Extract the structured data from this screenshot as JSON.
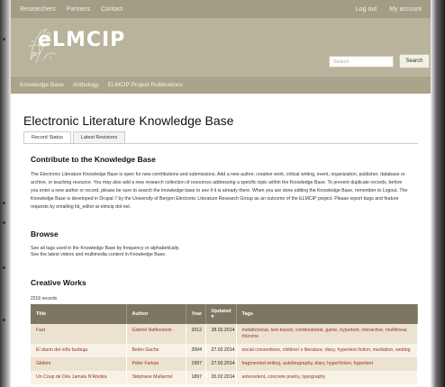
{
  "topbar": {
    "left": [
      "Researchers",
      "Partners",
      "Contact"
    ],
    "right": [
      "Log out",
      "My account"
    ]
  },
  "header": {
    "logo_text": "eLMCIP",
    "search_placeholder": "Search",
    "search_button": "Search"
  },
  "mainnav": [
    "Knowledge Base",
    "Anthology",
    "ELMCIP Project Publications"
  ],
  "page": {
    "title": "Electronic Literature Knowledge Base",
    "tabs": [
      "Record Status",
      "Latest Revisions"
    ]
  },
  "contribute": {
    "heading": "Contribute to the Knowledge Base",
    "text": "The Electronic Literature Knowledge Base is open for new contributions and submissions. Add a new author, creative work, critical writing, event, organization, publisher, database or archive, or teaching resource. You may also add a new research collection of resources addressing a specific topic within the Knowledge Base. To prevent duplicate records, before you enter a new author or record, please be sure to search the knowledge base to see if it is already there. When you are done editing the Knowledge Base, remember to Logout. The Knowledge Base is developed in Drupal 7 by the University of Bergen Electronic Literature Research Group as an outcome of the ELMCIP project. Please report bugs and feature requests by emailing kb_editor at elmcip dot net."
  },
  "browse": {
    "heading": "Browse",
    "line1": "See all tags used in the Knowledge Base by frequency or alphabetically.",
    "line2": "See the latest videos and multimedia content in Knowledge Base."
  },
  "creative_works": {
    "heading": "Creative Works",
    "records": "2216 records",
    "columns": [
      "Title",
      "Author",
      "Year",
      "Updated",
      "Tags"
    ],
    "sort_indicator": "▾",
    "rows": [
      {
        "title": "Fast",
        "author": "Gabriel Haflenstein",
        "year": "2012",
        "updated": "28.02.2014",
        "tags": "metafictional, text-based, combinatorial, game, hypertext, interactive, multilinear, rhizome"
      },
      {
        "title": "El diario del niño burbuja",
        "author": "Belén Gache",
        "year": "2004",
        "updated": "27.02.2014",
        "tags": "social conventions, children´s literature, diary, hypertext fiction, mediation, weblog"
      },
      {
        "title": "Gildem",
        "author": "Péter Farkas",
        "year": "1997",
        "updated": "27.02.2014",
        "tags": "fragmented writing, autobiography, diary, hyperfiction, hypertext"
      },
      {
        "title": "Un Coup de Dés Jamais N'Abolira",
        "author": "Stéphane Mallarmé",
        "year": "1897",
        "updated": "20.02.2014",
        "tags": "antecedent, concrete poetry, typography"
      }
    ]
  }
}
